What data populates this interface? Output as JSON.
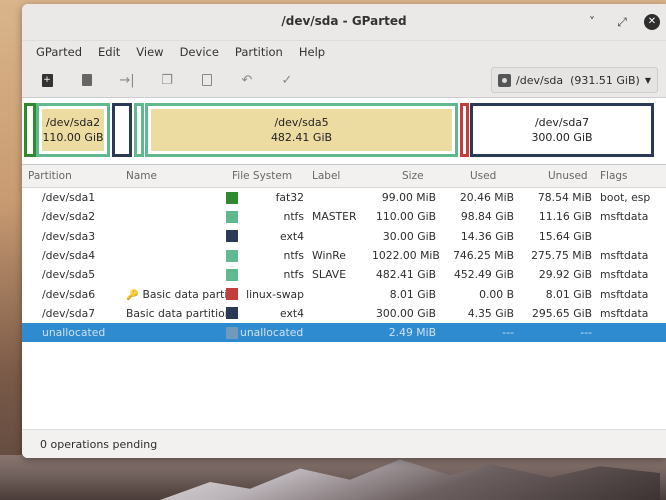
{
  "window": {
    "title": "/dev/sda - GParted",
    "controls": {
      "minimize": "˅",
      "maximize": "⤢",
      "close": "✕"
    }
  },
  "menu": [
    "GParted",
    "Edit",
    "View",
    "Device",
    "Partition",
    "Help"
  ],
  "toolbar": {
    "buttons": [
      {
        "name": "new-partition-icon",
        "glyph": "✚"
      },
      {
        "name": "delete-icon",
        "glyph": "🗑"
      },
      {
        "name": "resize-move-icon",
        "glyph": "→|"
      },
      {
        "name": "copy-icon",
        "glyph": "❐"
      },
      {
        "name": "paste-icon",
        "glyph": "📋"
      },
      {
        "name": "undo-icon",
        "glyph": "↶"
      },
      {
        "name": "apply-icon",
        "glyph": "✓"
      }
    ],
    "device_select": "/dev/sda  (931.51 GiB)"
  },
  "disk_map": [
    {
      "name": "/dev/sda2",
      "size": "110.00 GiB"
    },
    {
      "name": "/dev/sda5",
      "size": "482.41 GiB"
    },
    {
      "name": "/dev/sda7",
      "size": "300.00 GiB"
    }
  ],
  "columns": {
    "partition": "Partition",
    "name": "Name",
    "filesystem": "File System",
    "label": "Label",
    "size": "Size",
    "used": "Used",
    "unused": "Unused",
    "flags": "Flags"
  },
  "partitions": [
    {
      "partition": "/dev/sda1",
      "name": "",
      "fs": "fat32",
      "color": "#2f8a2f",
      "label": "",
      "size": "99.00 MiB",
      "used": "20.46 MiB",
      "unused": "78.54 MiB",
      "flags": "boot, esp"
    },
    {
      "partition": "/dev/sda2",
      "name": "",
      "fs": "ntfs",
      "color": "#5fb88e",
      "label": "MASTER",
      "size": "110.00 GiB",
      "used": "98.84 GiB",
      "unused": "11.16 GiB",
      "flags": "msftdata"
    },
    {
      "partition": "/dev/sda3",
      "name": "",
      "fs": "ext4",
      "color": "#2a3956",
      "label": "",
      "size": "30.00 GiB",
      "used": "14.36 GiB",
      "unused": "15.64 GiB",
      "flags": ""
    },
    {
      "partition": "/dev/sda4",
      "name": "",
      "fs": "ntfs",
      "color": "#5fb88e",
      "label": "WinRe",
      "size": "1022.00 MiB",
      "used": "746.25 MiB",
      "unused": "275.75 MiB",
      "flags": "msftdata"
    },
    {
      "partition": "/dev/sda5",
      "name": "",
      "fs": "ntfs",
      "color": "#5fb88e",
      "label": "SLAVE",
      "size": "482.41 GiB",
      "used": "452.49 GiB",
      "unused": "29.92 GiB",
      "flags": "msftdata"
    },
    {
      "partition": "/dev/sda6",
      "name": "Basic data partition",
      "fs": "linux-swap",
      "color": "#c43d3d",
      "label": "",
      "size": "8.01 GiB",
      "used": "0.00 B",
      "unused": "8.01 GiB",
      "flags": "msftdata"
    },
    {
      "partition": "/dev/sda7",
      "name": "Basic data partition",
      "fs": "ext4",
      "color": "#2a3956",
      "label": "",
      "size": "300.00 GiB",
      "used": "4.35 GiB",
      "unused": "295.65 GiB",
      "flags": "msftdata"
    },
    {
      "partition": "unallocated",
      "name": "",
      "fs": "unallocated",
      "color": "#a8a8a8",
      "label": "",
      "size": "2.49 MiB",
      "used": "---",
      "unused": "---",
      "flags": ""
    }
  ],
  "status": "0 operations pending"
}
